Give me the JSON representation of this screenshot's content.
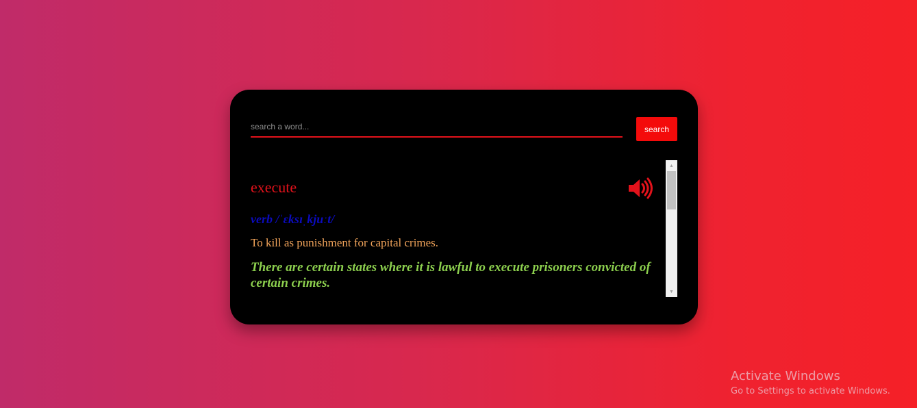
{
  "search": {
    "placeholder": "search a word...",
    "value": "",
    "button_label": "search"
  },
  "result": {
    "word": "execute",
    "part_of_speech": "verb",
    "phonetic": "/ˈɛksɪˌkjuːt/",
    "definition": "To kill as punishment for capital crimes.",
    "example": "There are certain states where it is lawful to execute prisoners convicted of certain crimes.",
    "audio_icon": "speaker-volume-icon"
  },
  "watermark": {
    "title": "Activate Windows",
    "subtitle": "Go to Settings to activate Windows."
  },
  "colors": {
    "accent": "#e3121b",
    "button": "#f40b0b",
    "card_background": "#000000",
    "part_of_speech": "#0b0bbd",
    "definition": "#f0a35a",
    "example": "#8ccf4e",
    "background_start": "#c02b69",
    "background_end": "#f52027"
  }
}
